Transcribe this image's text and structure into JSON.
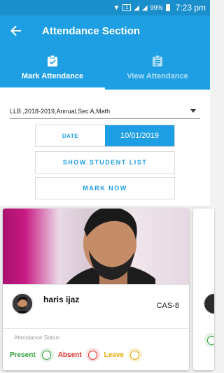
{
  "status_bar": {
    "sim_label": "1",
    "battery": "99%",
    "time": "7:23 pm"
  },
  "app_bar": {
    "title": "Attendance Section",
    "back_icon": "arrow-left-icon"
  },
  "tabs": [
    {
      "label": "Mark Attendance",
      "icon": "clipboard-check-icon",
      "active": true
    },
    {
      "label": "View Attendance",
      "icon": "clipboard-list-icon",
      "active": false
    }
  ],
  "form": {
    "course_selection": "LLB ,2018-2019,Annual,Sec A,Math",
    "date_label": "DATE",
    "date_value": "10/01/2019",
    "show_list_label": "SHOW STUDENT LIST",
    "mark_now_label": "MARK NOW"
  },
  "student_card": {
    "name": "haris ijaz",
    "roll_no": "CAS-8",
    "status_heading": "Attendance Status",
    "options": [
      "Present",
      "Absent",
      "Leave"
    ]
  },
  "colors": {
    "primary": "#1e9fe3",
    "status_bar": "#1a8fcc",
    "present": "#2e9e3a",
    "absent": "#e02b2b",
    "leave": "#e6a800"
  }
}
